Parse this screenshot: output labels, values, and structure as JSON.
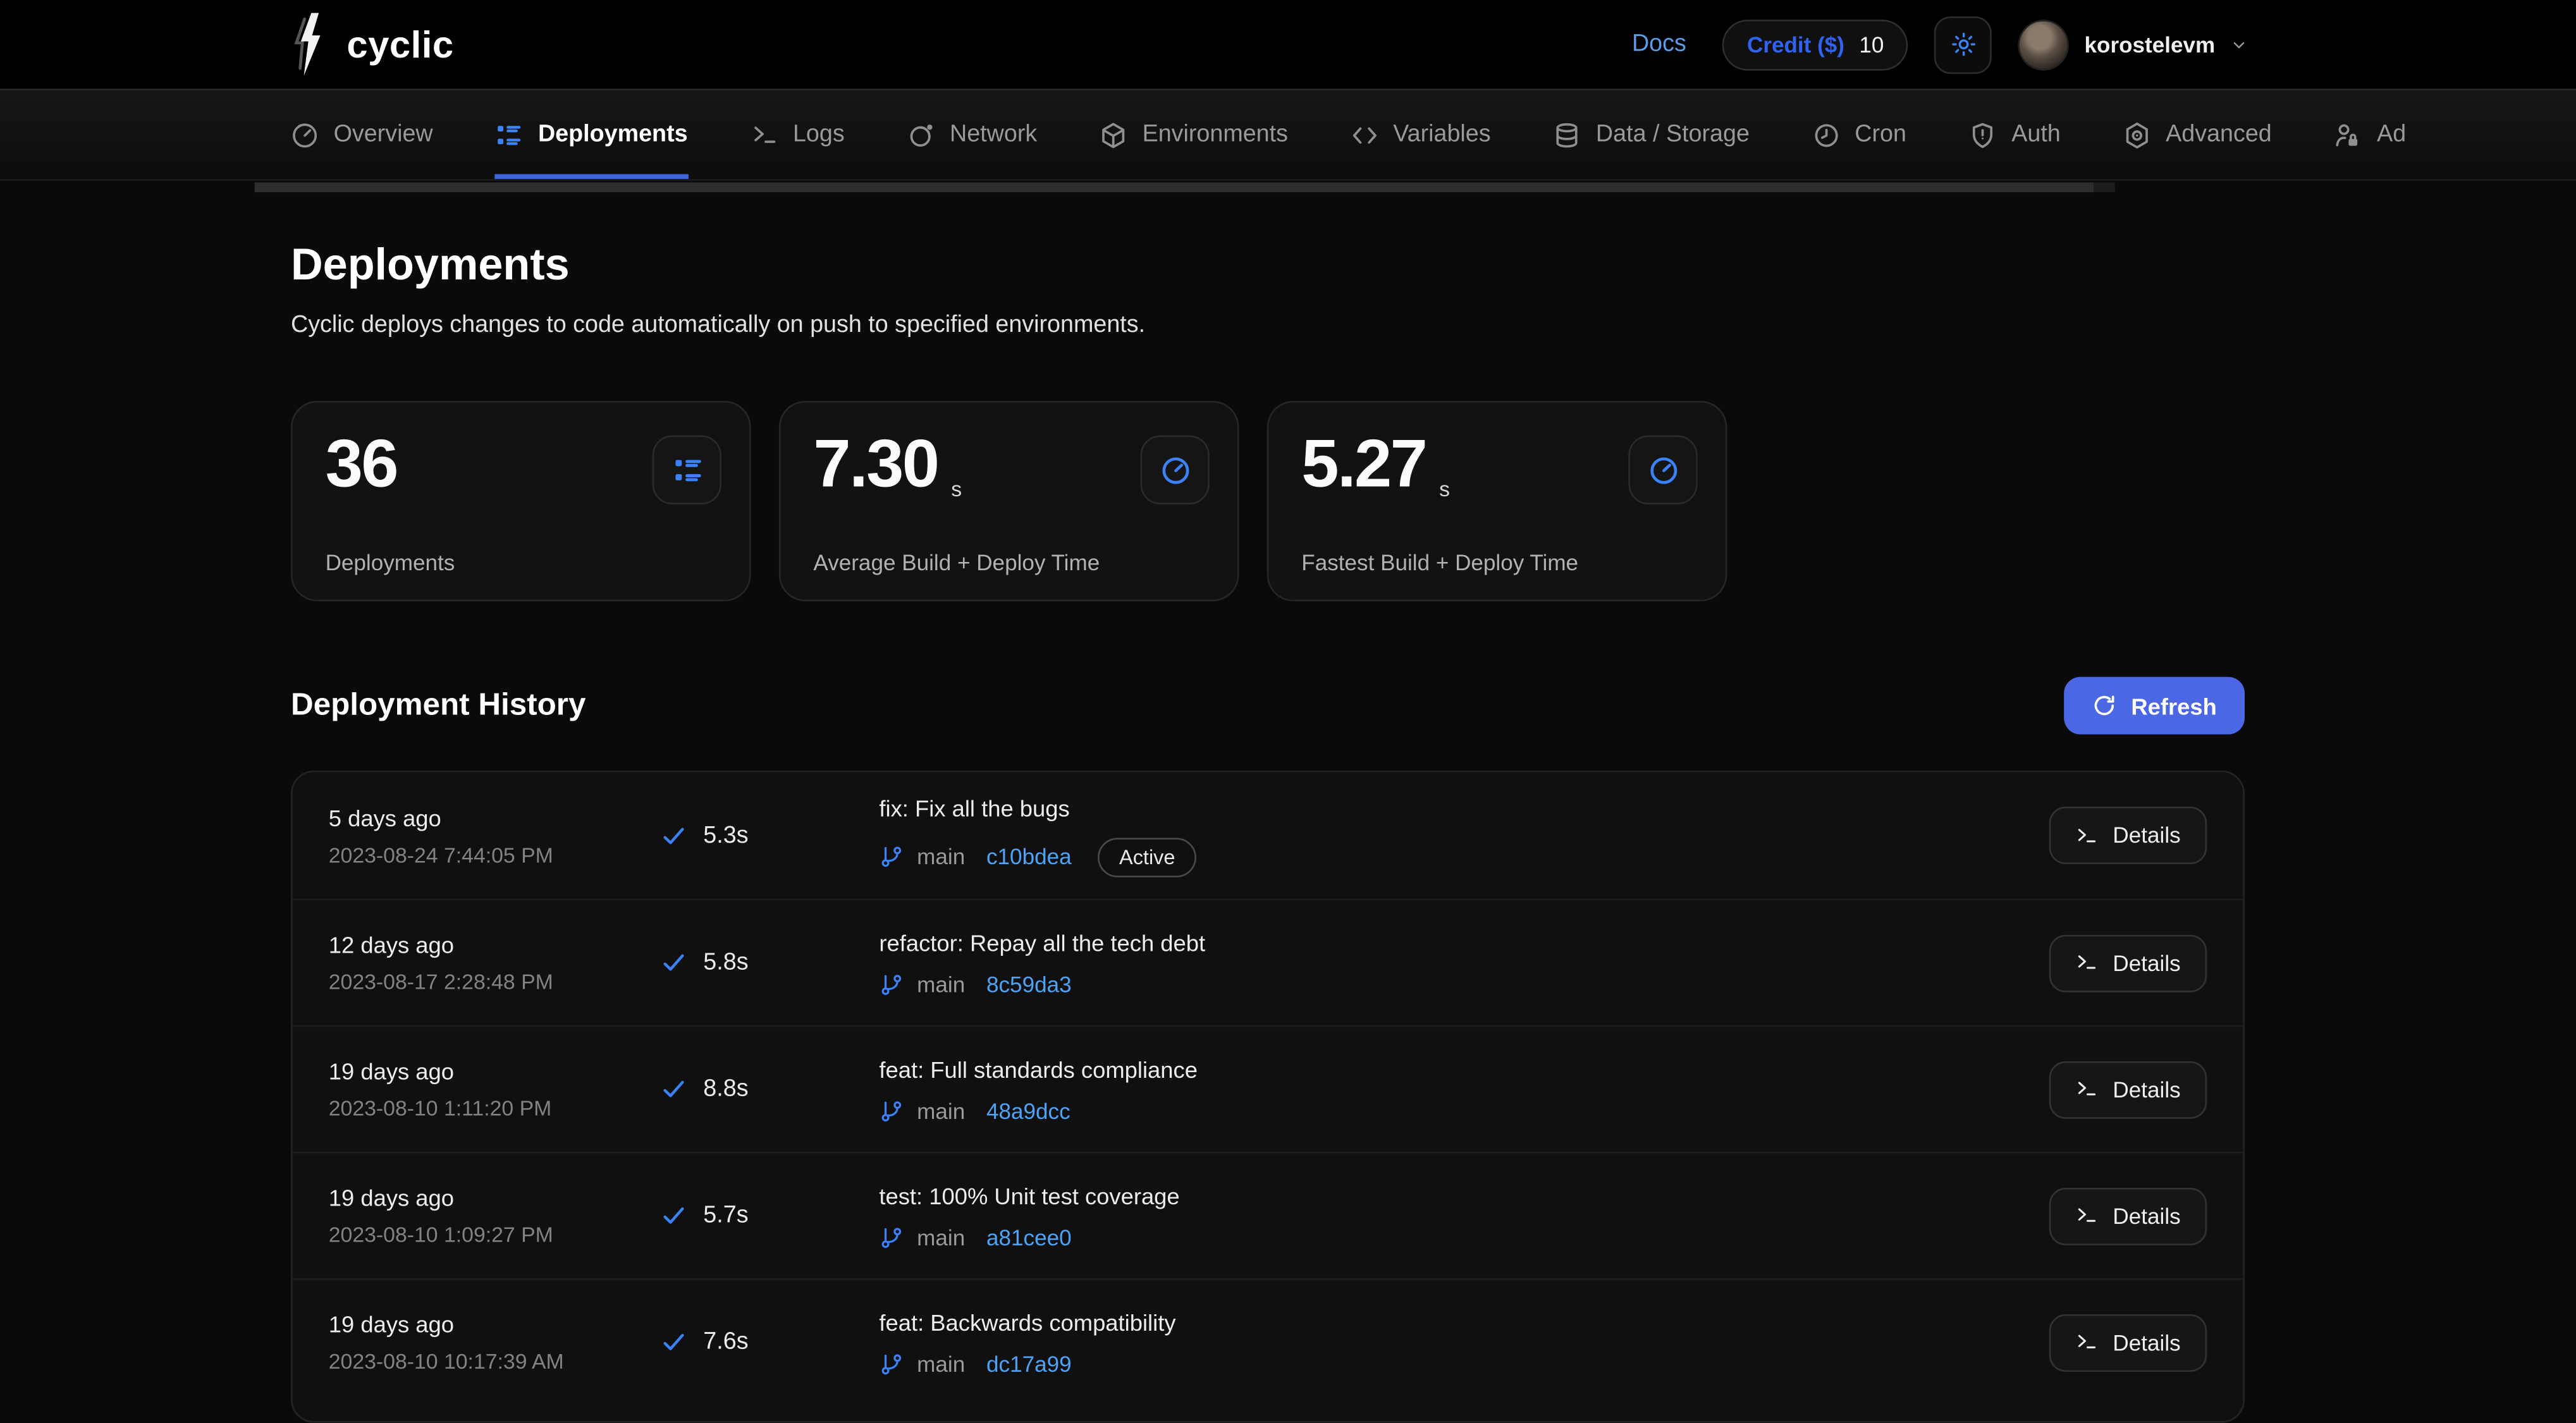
{
  "header": {
    "logo_text": "cyclic",
    "docs_label": "Docs",
    "credit_button": {
      "label": "Credit ($)",
      "value": "10"
    },
    "username": "korostelevm"
  },
  "nav": {
    "tabs": [
      {
        "label": "Overview",
        "icon": "gauge-icon",
        "active": false
      },
      {
        "label": "Deployments",
        "icon": "list-icon",
        "active": true
      },
      {
        "label": "Logs",
        "icon": "terminal-icon",
        "active": false
      },
      {
        "label": "Network",
        "icon": "network-icon",
        "active": false
      },
      {
        "label": "Environments",
        "icon": "cube-icon",
        "active": false
      },
      {
        "label": "Variables",
        "icon": "code-brackets-icon",
        "active": false
      },
      {
        "label": "Data / Storage",
        "icon": "database-icon",
        "active": false
      },
      {
        "label": "Cron",
        "icon": "clock-icon",
        "active": false
      },
      {
        "label": "Auth",
        "icon": "shield-icon",
        "active": false
      },
      {
        "label": "Advanced",
        "icon": "hexagon-gear-icon",
        "active": false
      },
      {
        "label": "Ad",
        "icon": "user-lock-icon",
        "active": false
      }
    ]
  },
  "page": {
    "title": "Deployments",
    "subtitle": "Cyclic deploys changes to code automatically on push to specified environments."
  },
  "stats": [
    {
      "value": "36",
      "unit": "",
      "label": "Deployments",
      "icon": "list-icon"
    },
    {
      "value": "7.30",
      "unit": "s",
      "label": "Average Build + Deploy Time",
      "icon": "timer-icon"
    },
    {
      "value": "5.27",
      "unit": "s",
      "label": "Fastest Build + Deploy Time",
      "icon": "timer-icon"
    }
  ],
  "history": {
    "title": "Deployment History",
    "refresh_label": "Refresh",
    "details_label": "Details",
    "rows": [
      {
        "relative_time": "5 days ago",
        "timestamp": "2023-08-24 7:44:05 PM",
        "duration": "5.3s",
        "message": "fix: Fix all the bugs",
        "branch": "main",
        "commit": "c10bdea",
        "badge": "Active"
      },
      {
        "relative_time": "12 days ago",
        "timestamp": "2023-08-17 2:28:48 PM",
        "duration": "5.8s",
        "message": "refactor: Repay all the tech debt",
        "branch": "main",
        "commit": "8c59da3",
        "badge": ""
      },
      {
        "relative_time": "19 days ago",
        "timestamp": "2023-08-10 1:11:20 PM",
        "duration": "8.8s",
        "message": "feat: Full standards compliance",
        "branch": "main",
        "commit": "48a9dcc",
        "badge": ""
      },
      {
        "relative_time": "19 days ago",
        "timestamp": "2023-08-10 1:09:27 PM",
        "duration": "5.7s",
        "message": "test: 100% Unit test coverage",
        "branch": "main",
        "commit": "a81cee0",
        "badge": ""
      },
      {
        "relative_time": "19 days ago",
        "timestamp": "2023-08-10 10:17:39 AM",
        "duration": "7.6s",
        "message": "feat: Backwards compatibility",
        "branch": "main",
        "commit": "dc17a99",
        "badge": ""
      }
    ]
  },
  "colors": {
    "accent_blue": "#3b82f6",
    "link_blue": "#4da3f7",
    "button_indigo": "#4b67e4",
    "tab_underline": "#3e63e0",
    "docs_blue": "#5b9ce6"
  }
}
